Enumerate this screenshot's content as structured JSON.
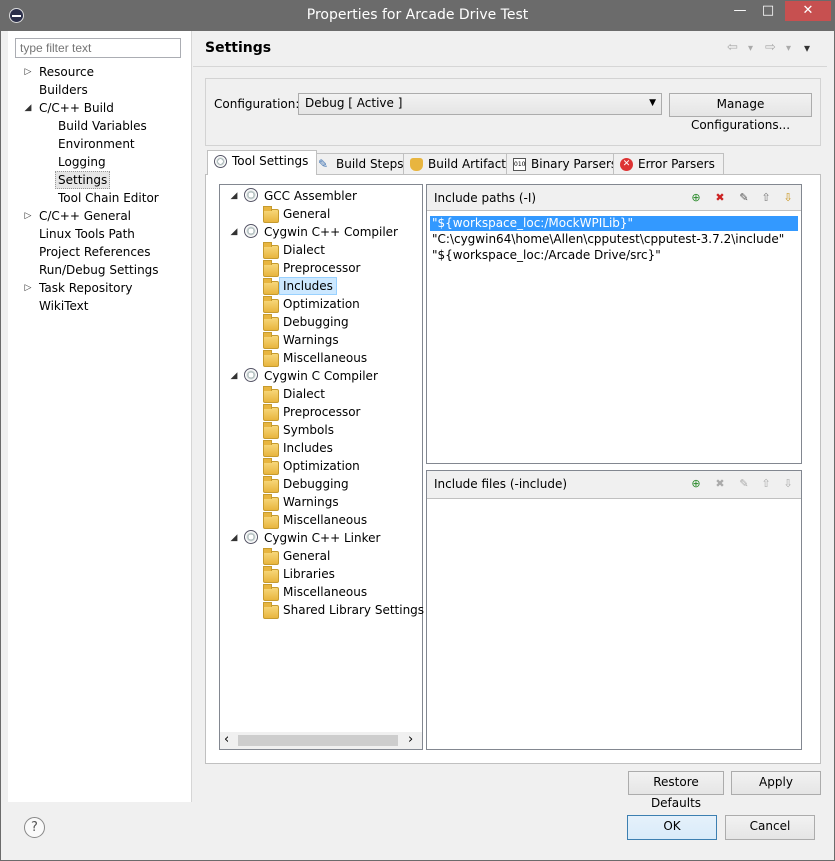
{
  "window": {
    "title": "Properties for Arcade Drive Test",
    "minimize": "—",
    "maximize": "□",
    "close": "✕"
  },
  "filter": {
    "placeholder": "type filter text"
  },
  "nav": {
    "items": [
      {
        "label": "Resource",
        "twisty": "▷"
      },
      {
        "label": "Builders",
        "twisty": ""
      },
      {
        "label": "C/C++ Build",
        "twisty": "◢"
      },
      {
        "label": "Build Variables",
        "twisty": ""
      },
      {
        "label": "Environment",
        "twisty": ""
      },
      {
        "label": "Logging",
        "twisty": ""
      },
      {
        "label": "Settings",
        "twisty": ""
      },
      {
        "label": "Tool Chain Editor",
        "twisty": ""
      },
      {
        "label": "C/C++ General",
        "twisty": "▷"
      },
      {
        "label": "Linux Tools Path",
        "twisty": ""
      },
      {
        "label": "Project References",
        "twisty": ""
      },
      {
        "label": "Run/Debug Settings",
        "twisty": ""
      },
      {
        "label": "Task Repository",
        "twisty": "▷"
      },
      {
        "label": "WikiText",
        "twisty": ""
      }
    ]
  },
  "header": {
    "title": "Settings",
    "back": "⇦",
    "forward": "⇨",
    "dropdown": "▾",
    "menu": "▾"
  },
  "config": {
    "label": "Configuration:",
    "value": "Debug  [ Active ]",
    "manage_button": "Manage Configurations..."
  },
  "tabs": [
    {
      "label": "Tool Settings"
    },
    {
      "label": "Build Steps"
    },
    {
      "label": "Build Artifact"
    },
    {
      "label": "Binary Parsers"
    },
    {
      "label": "Error Parsers"
    }
  ],
  "tree": {
    "items": [
      {
        "label": "GCC Assembler",
        "level": 0,
        "twisty": "◢"
      },
      {
        "label": "General",
        "level": 1
      },
      {
        "label": "Cygwin C++ Compiler",
        "level": 0,
        "twisty": "◢"
      },
      {
        "label": "Dialect",
        "level": 1
      },
      {
        "label": "Preprocessor",
        "level": 1
      },
      {
        "label": "Includes",
        "level": 1,
        "selected": true
      },
      {
        "label": "Optimization",
        "level": 1
      },
      {
        "label": "Debugging",
        "level": 1
      },
      {
        "label": "Warnings",
        "level": 1
      },
      {
        "label": "Miscellaneous",
        "level": 1
      },
      {
        "label": "Cygwin C Compiler",
        "level": 0,
        "twisty": "◢"
      },
      {
        "label": "Dialect",
        "level": 1
      },
      {
        "label": "Preprocessor",
        "level": 1
      },
      {
        "label": "Symbols",
        "level": 1
      },
      {
        "label": "Includes",
        "level": 1
      },
      {
        "label": "Optimization",
        "level": 1
      },
      {
        "label": "Debugging",
        "level": 1
      },
      {
        "label": "Warnings",
        "level": 1
      },
      {
        "label": "Miscellaneous",
        "level": 1
      },
      {
        "label": "Cygwin C++ Linker",
        "level": 0,
        "twisty": "◢"
      },
      {
        "label": "General",
        "level": 1
      },
      {
        "label": "Libraries",
        "level": 1
      },
      {
        "label": "Miscellaneous",
        "level": 1
      },
      {
        "label": "Shared Library Settings",
        "level": 1
      }
    ],
    "scroll_left": "‹",
    "scroll_right": "›"
  },
  "include_paths": {
    "title": "Include paths (-I)",
    "rows": [
      "\"${workspace_loc:/MockWPILib}\"",
      "\"C:\\cygwin64\\home\\Allen\\cpputest\\cpputest-3.7.2\\include\"",
      "\"${workspace_loc:/Arcade Drive/src}\""
    ]
  },
  "include_files": {
    "title": "Include files (-include)",
    "rows": []
  },
  "buttons": {
    "restore": "Restore Defaults",
    "apply": "Apply",
    "ok": "OK",
    "cancel": "Cancel",
    "help": "?"
  },
  "colors": {
    "selection": "#3399ff",
    "titlebar": "#6b6b6b",
    "close": "#c75050"
  }
}
